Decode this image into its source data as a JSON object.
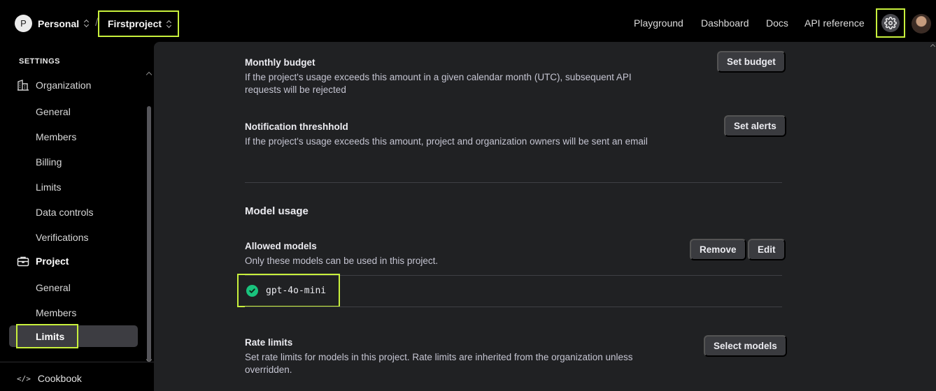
{
  "header": {
    "org_initial": "P",
    "org_name": "Personal",
    "separator": "/",
    "project_name": "Firstproject",
    "nav": [
      "Playground",
      "Dashboard",
      "Docs",
      "API reference"
    ]
  },
  "sidebar": {
    "title": "SETTINGS",
    "organization_label": "Organization",
    "organization_items": [
      "General",
      "Members",
      "Billing",
      "Limits",
      "Data controls",
      "Verifications"
    ],
    "project_label": "Project",
    "project_items": [
      "General",
      "Members",
      "Limits"
    ],
    "active_item": "Limits",
    "cookbook_label": "Cookbook"
  },
  "main": {
    "monthly_budget": {
      "title": "Monthly budget",
      "description": "If the project's usage exceeds this amount in a given calendar month (UTC), subsequent API requests will be rejected",
      "button": "Set budget"
    },
    "notification": {
      "title": "Notification threshhold",
      "description": "If the project's usage exceeds this amount, project and organization owners will be sent an email",
      "button": "Set alerts"
    },
    "model_usage_title": "Model usage",
    "allowed_models": {
      "title": "Allowed models",
      "description": "Only these models can be used in this project.",
      "remove_button": "Remove",
      "edit_button": "Edit",
      "models": [
        "gpt-4o-mini"
      ]
    },
    "rate_limits": {
      "title": "Rate limits",
      "description": "Set rate limits for models in this project. Rate limits are inherited from the organization unless overridden.",
      "button": "Select models"
    }
  },
  "colors": {
    "highlight": "#c8f03c",
    "check_green": "#19c37d",
    "panel_bg": "#202123",
    "button_bg": "#3a3b3f"
  }
}
